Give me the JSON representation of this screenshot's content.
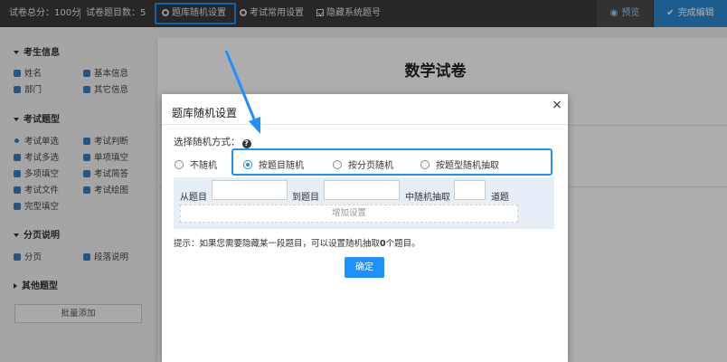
{
  "topbar": {
    "total_score": "试卷总分：100分",
    "question_count": "试卷题目数：5",
    "tab_random": "题库随机设置",
    "tab_common": "考试常用设置",
    "tab_hide": "隐藏系统题号",
    "preview": "预览",
    "finish": "完成编辑"
  },
  "sidebar": {
    "sec_info": "考生信息",
    "name": "姓名",
    "basic_info": "基本信息",
    "department": "部门",
    "other_info": "其它信息",
    "sec_types": "考试题型",
    "single": "考试单选",
    "judge": "考试判断",
    "multi": "考试多选",
    "blank_single": "单项填空",
    "blank_multi": "多项填空",
    "answer": "考试简答",
    "file": "考试文件",
    "draw": "考试绘图",
    "cloze": "完型填空",
    "sec_page": "分页说明",
    "page": "分页",
    "para": "段落说明",
    "sec_other": "其他题型",
    "batch_add": "批量添加"
  },
  "paper": {
    "title": "数学试卷"
  },
  "modal": {
    "title": "题库随机设置",
    "close": "×",
    "mode_label": "选择随机方式：",
    "options": [
      "不随机",
      "按题目随机",
      "按分页随机",
      "按题型随机抽取"
    ],
    "selected": "按题目随机",
    "from_label": "从题目",
    "to_label": "到题目",
    "pick_label": "中随机抽取",
    "unit_label": "道题",
    "add_setting": "增加设置",
    "tip_prefix": "提示：",
    "tip_text1": "如果您需要隐藏某一段题目，可以设置随机抽取",
    "tip_zero": "0",
    "tip_text2": "个题目。",
    "ok": "确定"
  },
  "colors": {
    "accent": "#1e90ff",
    "topbar": "#3a3a3a",
    "finish": "#2b8ad0"
  }
}
